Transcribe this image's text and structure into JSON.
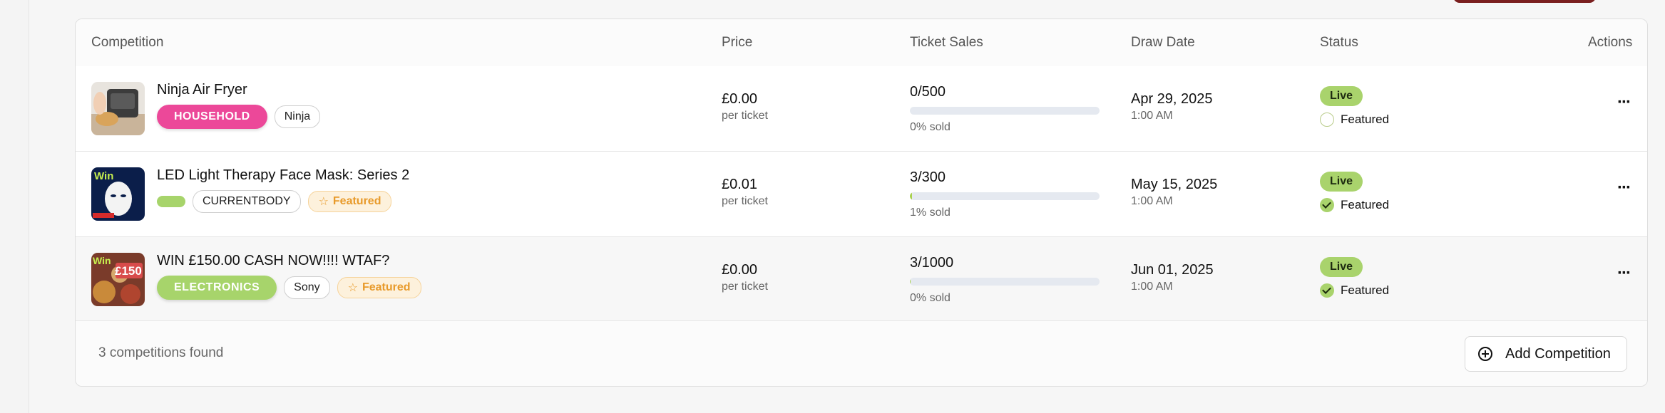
{
  "table": {
    "headers": {
      "competition": "Competition",
      "price": "Price",
      "ticket_sales": "Ticket Sales",
      "draw_date": "Draw Date",
      "status": "Status",
      "actions": "Actions"
    },
    "rows": [
      {
        "title": "Ninja Air Fryer",
        "category": "HOUSEHOLD",
        "category_color": "#ec4899",
        "brand": "Ninja",
        "featured_badge": "",
        "price": "£0.00",
        "price_sub": "per ticket",
        "sales": "0/500",
        "sold_fraction": 0.0,
        "sold_text": "0% sold",
        "date": "Apr 29, 2025",
        "time": "1:00 AM",
        "status": "Live",
        "featured_label": "Featured",
        "featured": false
      },
      {
        "title": "LED Light Therapy Face Mask: Series 2",
        "category": "",
        "category_color": "#a7d46b",
        "brand": "CURRENTBODY",
        "featured_badge": "Featured",
        "price": "£0.01",
        "price_sub": "per ticket",
        "sales": "3/300",
        "sold_fraction": 0.01,
        "sold_text": "1% sold",
        "date": "May 15, 2025",
        "time": "1:00 AM",
        "status": "Live",
        "featured_label": "Featured",
        "featured": true
      },
      {
        "title": "WIN £150.00 CASH NOW!!!! WTAF?",
        "category": "ELECTRONICS",
        "category_color": "#a7d46b",
        "brand": "Sony",
        "featured_badge": "Featured",
        "price": "£0.00",
        "price_sub": "per ticket",
        "sales": "3/1000",
        "sold_fraction": 0.003,
        "sold_text": "0% sold",
        "date": "Jun 01, 2025",
        "time": "1:00 AM",
        "status": "Live",
        "featured_label": "Featured",
        "featured": true
      }
    ]
  },
  "thumbnails": {
    "row2_text": "Win",
    "row3_text": "Win",
    "row3_amount": "£150"
  },
  "footer": {
    "count": "3 competitions found",
    "add_label": "Add Competition"
  },
  "colors": {
    "live": "#a9d36c",
    "featured_badge": "#e89a2a",
    "progress": "#a9d14f"
  }
}
